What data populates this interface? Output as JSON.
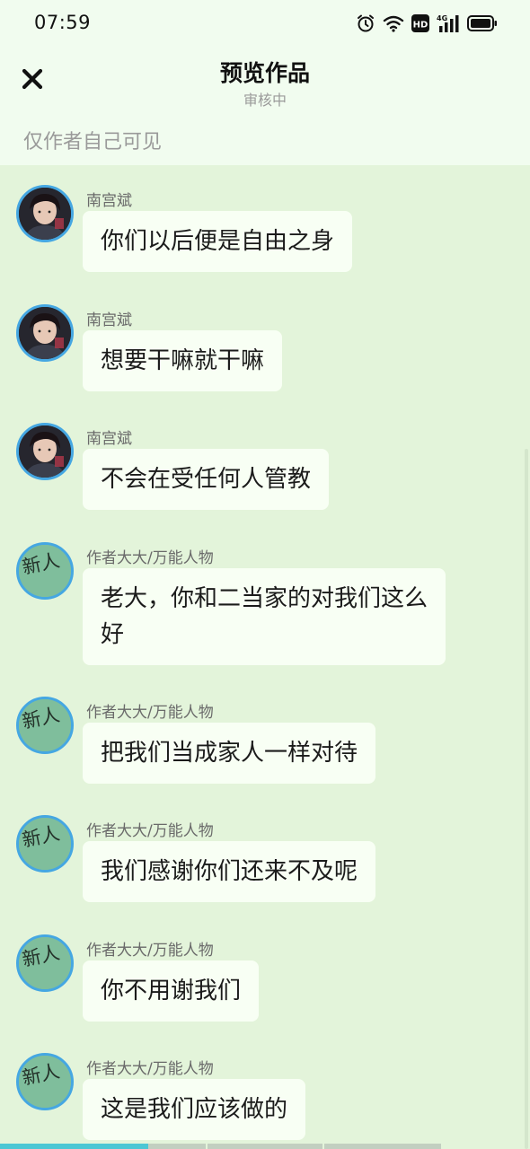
{
  "status_bar": {
    "time": "07:59",
    "icons": [
      "alarm-icon",
      "wifi-icon",
      "hd-icon",
      "signal-4g-icon",
      "battery-icon"
    ],
    "hd_label": "HD",
    "network_label": "4G"
  },
  "header": {
    "close_icon": "close-icon",
    "title": "预览作品",
    "subtitle": "审核中",
    "visibility_note": "仅作者自己可见"
  },
  "colors": {
    "background": "#e3f4da",
    "header_background": "#f1fcef",
    "bubble": "#f8fff4",
    "avatar_border": "#45a7e2",
    "progress_active": "#4cc7d4"
  },
  "messages": [
    {
      "sender": "南宫斌",
      "text": "你们以后便是自由之身",
      "avatar": "photo-avatar"
    },
    {
      "sender": "南宫斌",
      "text": "想要干嘛就干嘛",
      "avatar": "photo-avatar"
    },
    {
      "sender": "南宫斌",
      "text": "不会在受任何人管教",
      "avatar": "photo-avatar"
    },
    {
      "sender": "作者大大/万能人物",
      "text": "老大，你和二当家的对我们这么好",
      "avatar": "new-badge-avatar"
    },
    {
      "sender": "作者大大/万能人物",
      "text": "把我们当成家人一样对待",
      "avatar": "new-badge-avatar"
    },
    {
      "sender": "作者大大/万能人物",
      "text": "我们感谢你们还来不及呢",
      "avatar": "new-badge-avatar"
    },
    {
      "sender": "作者大大/万能人物",
      "text": "你不用谢我们",
      "avatar": "new-badge-avatar"
    },
    {
      "sender": "作者大大/万能人物",
      "text": "这是我们应该做的",
      "avatar": "new-badge-avatar"
    }
  ],
  "avatar_badge_text": "新人",
  "reading_progress": 0.28
}
